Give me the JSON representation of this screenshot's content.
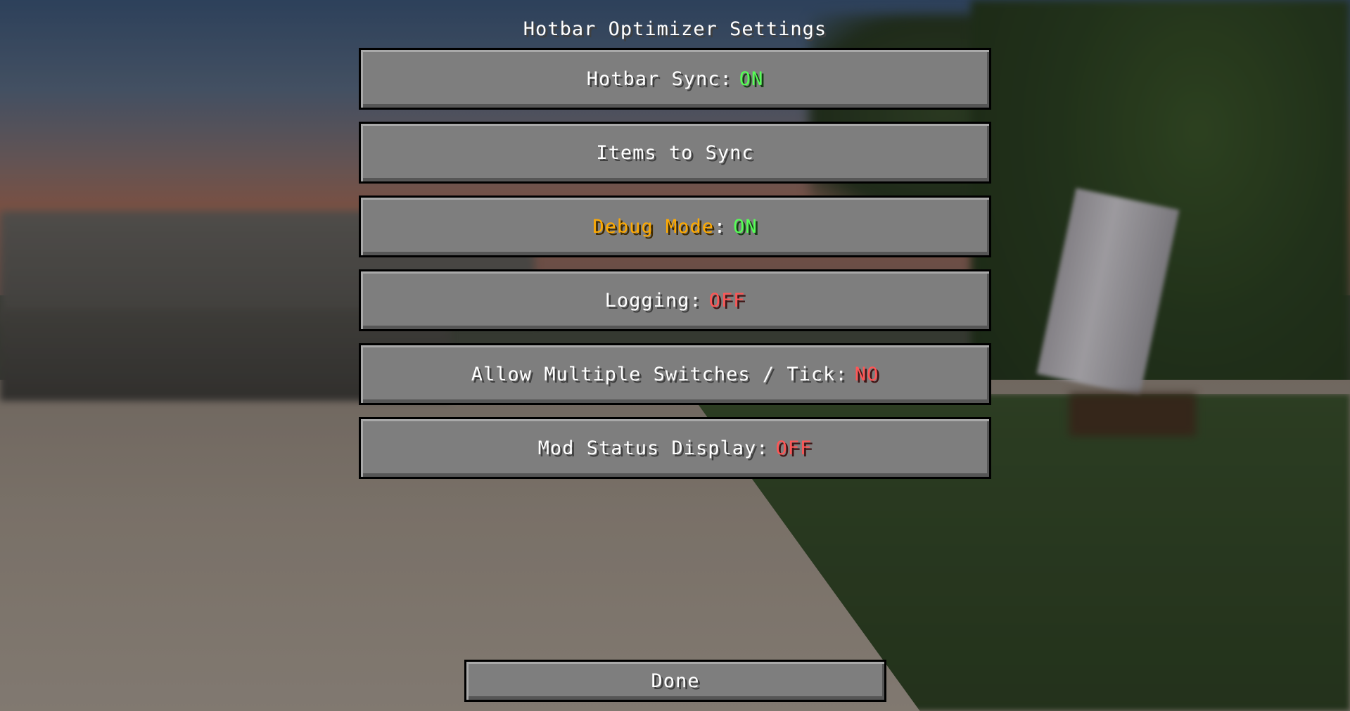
{
  "screen": {
    "title": "Hotbar Optimizer Settings"
  },
  "options": [
    {
      "label": "Hotbar Sync:",
      "value": "ON",
      "value_color": "#55ff55"
    },
    {
      "label": "Items to Sync"
    },
    {
      "label": "Debug Mode",
      "label_suffix": ":",
      "value": "ON",
      "value_color": "#55ff55",
      "label_color": "#ffaa00"
    },
    {
      "label": "Logging:",
      "value": "OFF",
      "value_color": "#ff5555"
    },
    {
      "label": "Allow Multiple Switches / Tick:",
      "value": "NO",
      "value_color": "#ff5555"
    },
    {
      "label": "Mod Status Display:",
      "value": "OFF",
      "value_color": "#ff5555"
    }
  ],
  "footer": {
    "done_label": "Done"
  }
}
